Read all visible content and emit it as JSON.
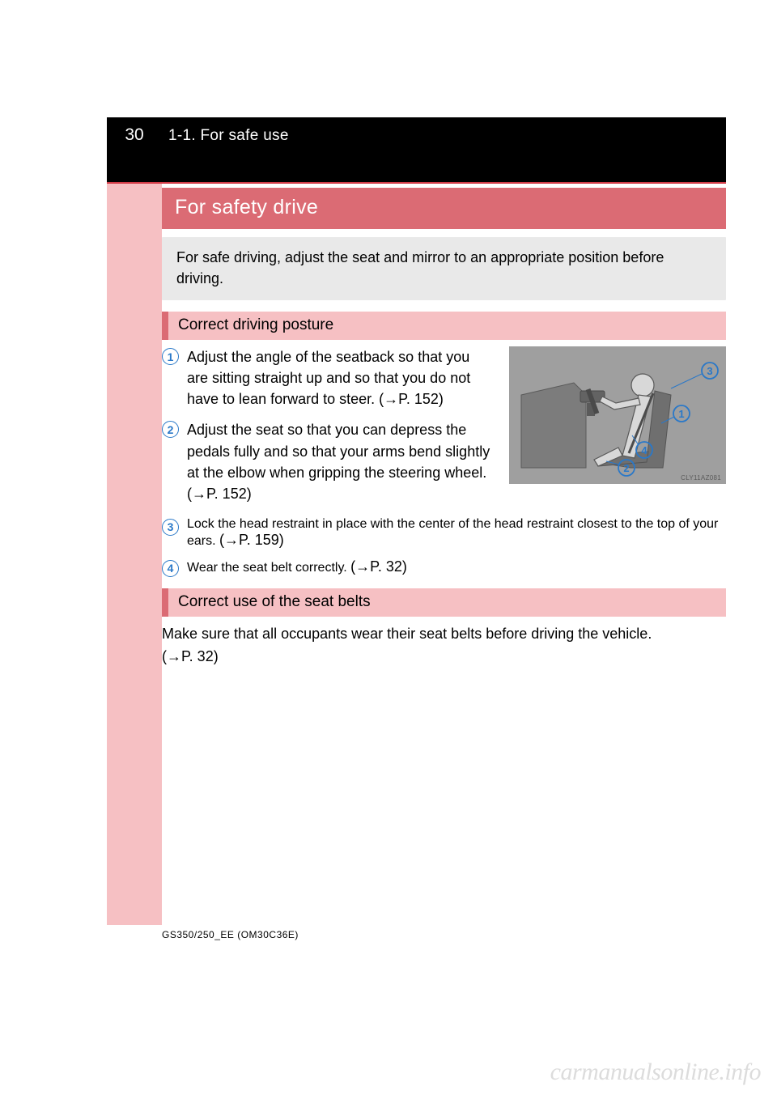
{
  "page": {
    "number": "30",
    "breadcrumb": "1-1. For safe use"
  },
  "title": "For safety drive",
  "intro": "For safe driving, adjust the seat and mirror to an appropriate position before driving.",
  "posture": {
    "header": "Correct driving posture",
    "items": [
      {
        "num": "1",
        "text": "Adjust the angle of the seatback so that you are sitting straight up and so that you do not have to lean forward to steer.",
        "ref": "(→P. 152)"
      },
      {
        "num": "2",
        "text": "Adjust the seat so that you can depress the pedals fully and so that your arms bend slightly at the elbow when gripping the steering wheel.",
        "ref": "(→P. 152)"
      },
      {
        "num": "3",
        "text": "Lock the head restraint in place with the center of the head restraint closest to the top of your ears.",
        "ref": "(→P. 159)"
      },
      {
        "num": "4",
        "text": "Wear the seat belt correctly.",
        "ref": "(→P. 32)"
      }
    ],
    "image_caption": "CLY11AZ081"
  },
  "belts": {
    "header": "Correct use of the seat belts",
    "lead": "Make sure that all occupants wear their seat belts before driving the vehicle.",
    "ref": "(→P. 32)"
  },
  "footer": {
    "code": "GS350/250_EE (OM30C36E)"
  },
  "watermark": "carmanualsonline.info"
}
